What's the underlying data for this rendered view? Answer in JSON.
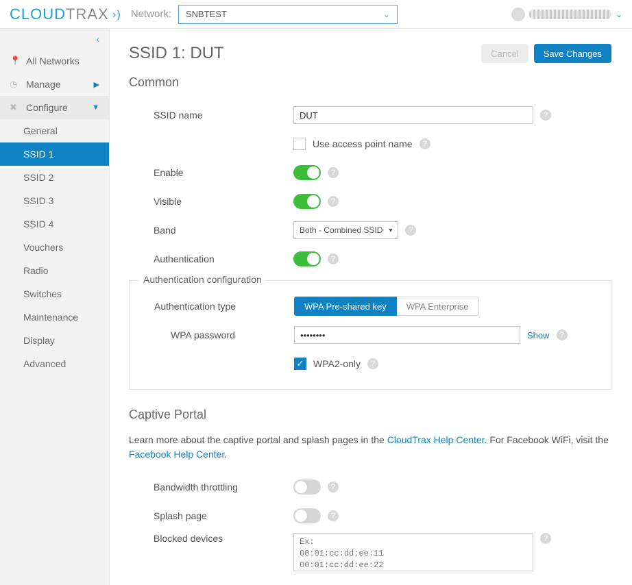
{
  "brand": {
    "part1": "CLOUD",
    "part2": "TRAX"
  },
  "topbar": {
    "network_label": "Network:",
    "network_value": "SNBTEST",
    "user_display": "tttt…"
  },
  "sidebar": {
    "items": [
      {
        "icon": "pin",
        "label": "All Networks"
      },
      {
        "icon": "gauge",
        "label": "Manage",
        "caret": "▶",
        "caret_color": "#0f82c4"
      },
      {
        "icon": "tools",
        "label": "Configure",
        "caret": "▼",
        "active": true
      }
    ],
    "sub": [
      {
        "label": "General"
      },
      {
        "label": "SSID 1",
        "selected": true
      },
      {
        "label": "SSID 2"
      },
      {
        "label": "SSID 3"
      },
      {
        "label": "SSID 4"
      },
      {
        "label": "Vouchers"
      },
      {
        "label": "Radio"
      },
      {
        "label": "Switches"
      },
      {
        "label": "Maintenance"
      },
      {
        "label": "Display"
      },
      {
        "label": "Advanced"
      }
    ]
  },
  "buttons": {
    "cancel": "Cancel",
    "save": "Save Changes"
  },
  "page": {
    "title": "SSID 1: DUT",
    "section_common": "Common",
    "section_captive": "Captive Portal"
  },
  "common": {
    "ssid_name_label": "SSID name",
    "ssid_name_value": "DUT",
    "use_ap_name_label": "Use access point name",
    "enable_label": "Enable",
    "visible_label": "Visible",
    "band_label": "Band",
    "band_value": "Both - Combined SSID",
    "auth_label": "Authentication"
  },
  "auth": {
    "fieldset_title": "Authentication configuration",
    "type_label": "Authentication type",
    "opt_psk": "WPA Pre-shared key",
    "opt_ent": "WPA Enterprise",
    "pwd_label": "WPA password",
    "pwd_value": "••••••••",
    "show": "Show",
    "wpa2_only": "WPA2-only"
  },
  "captive": {
    "intro_1": "Learn more about the captive portal and splash pages in the ",
    "link_1": "CloudTrax Help Center",
    "intro_2": ". For Facebook WiFi, visit the ",
    "link_2": "Facebook Help Center",
    "intro_3": ".",
    "bw_label": "Bandwidth throttling",
    "splash_label": "Splash page",
    "blocked_label": "Blocked devices",
    "blocked_placeholder": "Ex:\n00:01:cc:dd:ee:11\n00:01:cc:dd:ee:22"
  }
}
